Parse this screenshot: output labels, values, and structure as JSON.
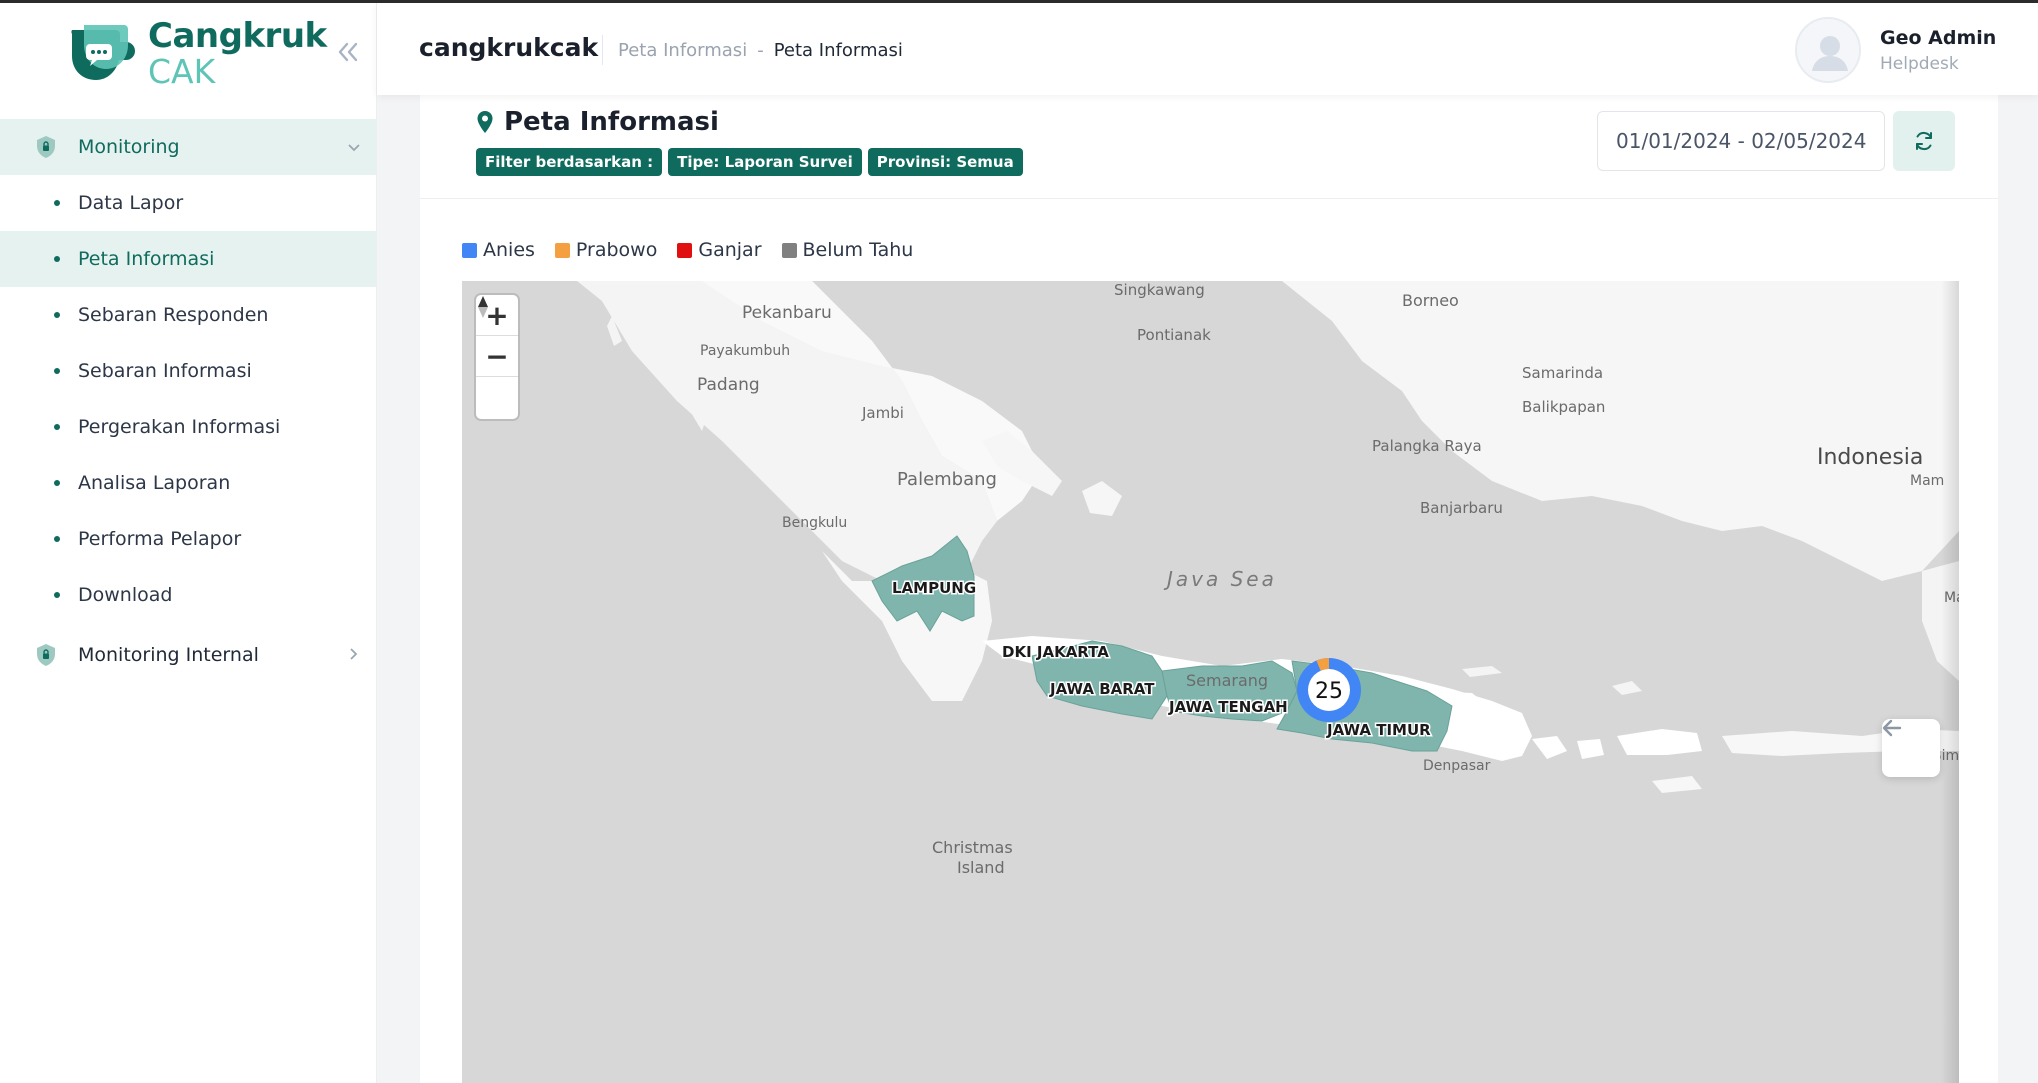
{
  "brand": {
    "name": "Cangkruk",
    "sub": "CAK"
  },
  "sidebar": {
    "groups": [
      {
        "label": "Monitoring",
        "items": [
          {
            "label": "Data Lapor"
          },
          {
            "label": "Peta Informasi"
          },
          {
            "label": "Sebaran Responden"
          },
          {
            "label": "Sebaran Informasi"
          },
          {
            "label": "Pergerakan Informasi"
          },
          {
            "label": "Analisa Laporan"
          },
          {
            "label": "Performa Pelapor"
          },
          {
            "label": "Download"
          }
        ]
      },
      {
        "label": "Monitoring Internal"
      }
    ]
  },
  "header": {
    "app_name": "cangkrukcak",
    "breadcrumb": [
      "Peta Informasi",
      "-",
      "Peta Informasi"
    ],
    "user": {
      "name": "Geo Admin",
      "role": "Helpdesk"
    }
  },
  "page": {
    "title": "Peta Informasi",
    "filters": [
      "Filter berdasarkan :",
      "Tipe: Laporan Survei",
      "Provinsi: Semua"
    ],
    "date_range": "01/01/2024 - 02/05/2024"
  },
  "legend": [
    {
      "label": "Anies",
      "color": "#4285f4"
    },
    {
      "label": "Prabowo",
      "color": "#f4a040"
    },
    {
      "label": "Ganjar",
      "color": "#e01010"
    },
    {
      "label": "Belum Tahu",
      "color": "#808080"
    }
  ],
  "map": {
    "province_color": "#7fb5ad",
    "provinces": [
      "LAMPUNG",
      "DKI JAKARTA",
      "JAWA BARAT",
      "JAWA TENGAH",
      "JAWA TIMUR"
    ],
    "places": [
      "Singkawang",
      "Borneo",
      "Pekanbaru",
      "Pontianak",
      "Payakumbuh",
      "Samarinda",
      "Padang",
      "Jambi",
      "Balikpapan",
      "Palangka Raya",
      "Indonesia",
      "Palembang",
      "Mam",
      "Banjarbaru",
      "Bengkulu",
      "Java Sea",
      "Ma",
      "Semarang",
      "Denpasar",
      "Bima",
      "Christmas",
      "Island"
    ],
    "cluster": {
      "count": "25",
      "anies": 23,
      "prabowo": 2
    },
    "controls": {
      "zoom_in": "+",
      "zoom_out": "−"
    }
  }
}
